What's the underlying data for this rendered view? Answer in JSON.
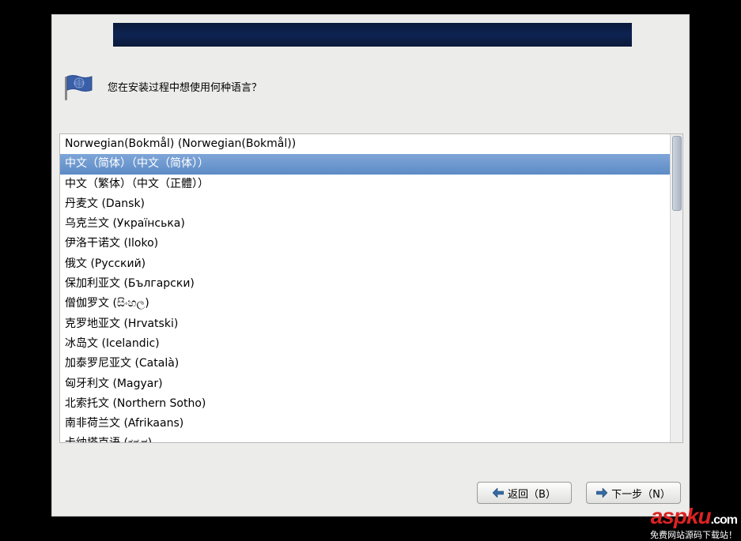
{
  "prompt": "您在安装过程中想使用何种语言？",
  "languages": [
    {
      "label": "Norwegian(Bokmål) (Norwegian(Bokmål))",
      "selected": false
    },
    {
      "label": "中文（简体）（中文（简体））",
      "selected": true
    },
    {
      "label": "中文（繁体）（中文（正體））",
      "selected": false
    },
    {
      "label": "丹麦文 (Dansk)",
      "selected": false
    },
    {
      "label": "乌克兰文 (Українська)",
      "selected": false
    },
    {
      "label": "伊洛干诺文 (Iloko)",
      "selected": false
    },
    {
      "label": "俄文 (Русский)",
      "selected": false
    },
    {
      "label": "保加利亚文 (Български)",
      "selected": false
    },
    {
      "label": "僧伽罗文 (සිංහල)",
      "selected": false
    },
    {
      "label": "克罗地亚文 (Hrvatski)",
      "selected": false
    },
    {
      "label": "冰岛文 (Icelandic)",
      "selected": false
    },
    {
      "label": "加泰罗尼亚文 (Català)",
      "selected": false
    },
    {
      "label": "匈牙利文 (Magyar)",
      "selected": false
    },
    {
      "label": "北索托文 (Northern Sotho)",
      "selected": false
    },
    {
      "label": "南非荷兰文 (Afrikaans)",
      "selected": false
    },
    {
      "label": "卡纳塔克语 (ಕನ್ನಡ)",
      "selected": false
    }
  ],
  "buttons": {
    "back": "返回（B）",
    "next": "下一步（N）"
  },
  "watermark": {
    "brand_main": "aspku",
    "brand_suffix": ".com",
    "tagline": "免费网站源码下载站！"
  }
}
